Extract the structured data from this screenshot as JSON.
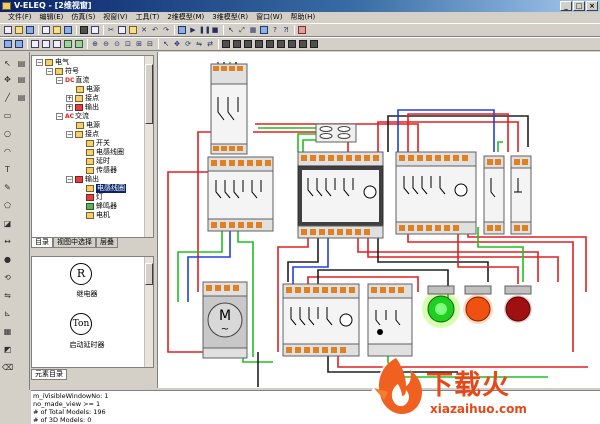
{
  "window": {
    "title": "V-ELEQ - [2维视窗]",
    "buttons": [
      "_",
      "□",
      "×"
    ]
  },
  "menu": [
    "文件(F)",
    "编辑(E)",
    "仿真(S)",
    "视窗(V)",
    "工具(T)",
    "2维模型(M)",
    "3维模型(R)",
    "窗口(W)",
    "帮助(H)"
  ],
  "tree": {
    "nodes": [
      {
        "label": "电气",
        "level": 0,
        "icon": "folder-icon"
      },
      {
        "label": "符号",
        "level": 1,
        "icon": "folder-icon"
      },
      {
        "label": "直流",
        "level": 2,
        "icon": "dc-icon",
        "prefix": "DC"
      },
      {
        "label": "电源",
        "level": 3,
        "icon": "power-icon"
      },
      {
        "label": "接点",
        "level": 3,
        "icon": "contact-icon"
      },
      {
        "label": "输出",
        "level": 3,
        "icon": "output-icon"
      },
      {
        "label": "交流",
        "level": 2,
        "icon": "ac-icon",
        "prefix": "AC"
      },
      {
        "label": "电源",
        "level": 3,
        "icon": "power-icon"
      },
      {
        "label": "接点",
        "level": 3,
        "icon": "contact-icon"
      },
      {
        "label": "开关",
        "level": 4,
        "icon": "switch-icon"
      },
      {
        "label": "电感线圈",
        "level": 4,
        "icon": "coil-icon"
      },
      {
        "label": "延时",
        "level": 4,
        "icon": "timer-icon"
      },
      {
        "label": "传感器",
        "level": 4,
        "icon": "sensor-icon"
      },
      {
        "label": "输出",
        "level": 3,
        "icon": "output-icon"
      },
      {
        "label": "电感线圈",
        "level": 4,
        "icon": "coil-icon",
        "selected": true
      },
      {
        "label": "灯",
        "level": 4,
        "icon": "lamp-icon"
      },
      {
        "label": "蜂鸣器",
        "level": 4,
        "icon": "buzzer-icon"
      },
      {
        "label": "电机",
        "level": 4,
        "icon": "motor-icon"
      }
    ]
  },
  "tabs": [
    "目录",
    "视图中选择",
    "层叠"
  ],
  "elements": [
    {
      "symbol": "R",
      "label": "继电器"
    },
    {
      "symbol": "Ton",
      "label": "启动延时器"
    }
  ],
  "elements_tab": "元素目录",
  "status": [
    "m_iVisibleWindowNo: 1",
    "no_made_view >= 1",
    "# of Total Models: 196",
    "# of 3D Models: 0"
  ],
  "canvas": {
    "motor_label": "M",
    "motor_sub": "~",
    "lamps": [
      {
        "color": "#20d020",
        "glow": "#b0ff60",
        "name": "green-lamp"
      },
      {
        "color": "#f05010",
        "glow": "#ffa060",
        "name": "orange-lamp"
      },
      {
        "color": "#a01010",
        "glow": "#e06060",
        "name": "red-lamp"
      }
    ]
  },
  "watermark": {
    "text": "下载火",
    "sub": "xiazaihuo.com"
  },
  "colors": {
    "wire_red": "#e02020",
    "wire_green": "#20c020",
    "wire_blue": "#2040e0",
    "wire_black": "#202020",
    "terminal_orange": "#e08020",
    "accent": "#e84818"
  }
}
